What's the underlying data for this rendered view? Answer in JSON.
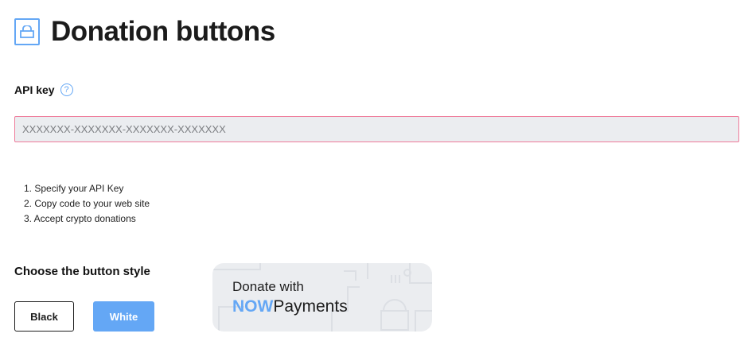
{
  "header": {
    "title": "Donation buttons",
    "icon": "lock-icon"
  },
  "api": {
    "label": "API key",
    "help_icon": "question-icon",
    "help_symbol": "?",
    "placeholder": "XXXXXXX-XXXXXXX-XXXXXXX-XXXXXXX",
    "value": ""
  },
  "steps": [
    "1. Specify your API Key",
    "2. Copy code to your web site",
    "3. Accept crypto donations"
  ],
  "style": {
    "label": "Choose the button style",
    "options": [
      "Black",
      "White"
    ],
    "selected": "White"
  },
  "preview": {
    "line1": "Donate with",
    "brand_now": "NOW",
    "brand_payments": "Payments"
  },
  "colors": {
    "accent": "#64a7f5",
    "input_border_error": "#ef7b9a",
    "input_bg": "#ebedf0"
  }
}
